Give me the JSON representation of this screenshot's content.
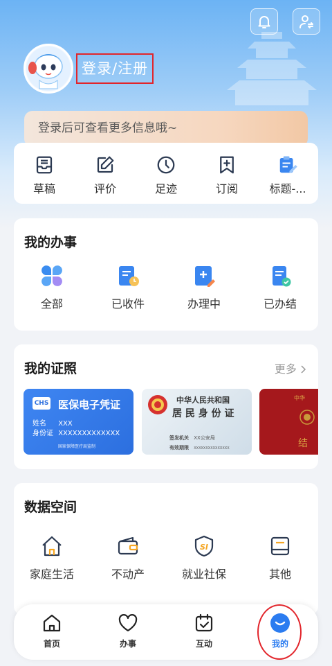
{
  "header": {
    "login_label": "登录/注册",
    "promo_text": "登录后可查看更多信息哦~",
    "notification_icon": "bell-icon",
    "switch_icon": "user-switch-icon"
  },
  "quick_links": [
    {
      "label": "草稿",
      "icon": "inbox-icon"
    },
    {
      "label": "评价",
      "icon": "edit-icon"
    },
    {
      "label": "足迹",
      "icon": "clock-icon"
    },
    {
      "label": "订阅",
      "icon": "bookmark-add-icon"
    },
    {
      "label": "标题-...",
      "icon": "clipboard-edit-icon"
    }
  ],
  "my_affairs": {
    "title": "我的办事",
    "items": [
      {
        "label": "全部",
        "icon": "grid-petals-icon"
      },
      {
        "label": "已收件",
        "icon": "document-clock-icon"
      },
      {
        "label": "办理中",
        "icon": "document-pen-icon"
      },
      {
        "label": "已办结",
        "icon": "document-check-icon"
      }
    ]
  },
  "my_certificates": {
    "title": "我的证照",
    "more_label": "更多",
    "medical": {
      "logo": "CHS",
      "title": "医保电子凭证",
      "name_label": "姓名",
      "name_value": "XXX",
      "id_label": "身份证",
      "id_value": "XXXXXXXXXXXXX",
      "footer": "国家保障医疗局监制"
    },
    "id_card": {
      "line1": "中华人民共和国",
      "line2": "居 民 身 份 证",
      "authority_label": "签发机关",
      "authority_value": "XX公安局",
      "valid_label": "有效期限",
      "valid_value": "XXXXXXXXXXXXXXX"
    },
    "third": {
      "top_text": "中华",
      "bottom_text": "结"
    }
  },
  "data_space": {
    "title": "数据空间",
    "items": [
      {
        "label": "家庭生活",
        "icon": "house-icon"
      },
      {
        "label": "不动产",
        "icon": "wallet-icon"
      },
      {
        "label": "就业社保",
        "icon": "shield-si-icon"
      },
      {
        "label": "其他",
        "icon": "book-icon"
      }
    ],
    "si_text": "SI"
  },
  "tabbar": {
    "items": [
      {
        "label": "首页",
        "icon": "home-icon"
      },
      {
        "label": "办事",
        "icon": "heart-icon"
      },
      {
        "label": "互动",
        "icon": "calendar-check-icon"
      },
      {
        "label": "我的",
        "icon": "smile-icon"
      }
    ],
    "active": "我的"
  },
  "colors": {
    "accent": "#2b7cf0",
    "highlight": "#e2252b",
    "background": "#f1f3f7"
  }
}
